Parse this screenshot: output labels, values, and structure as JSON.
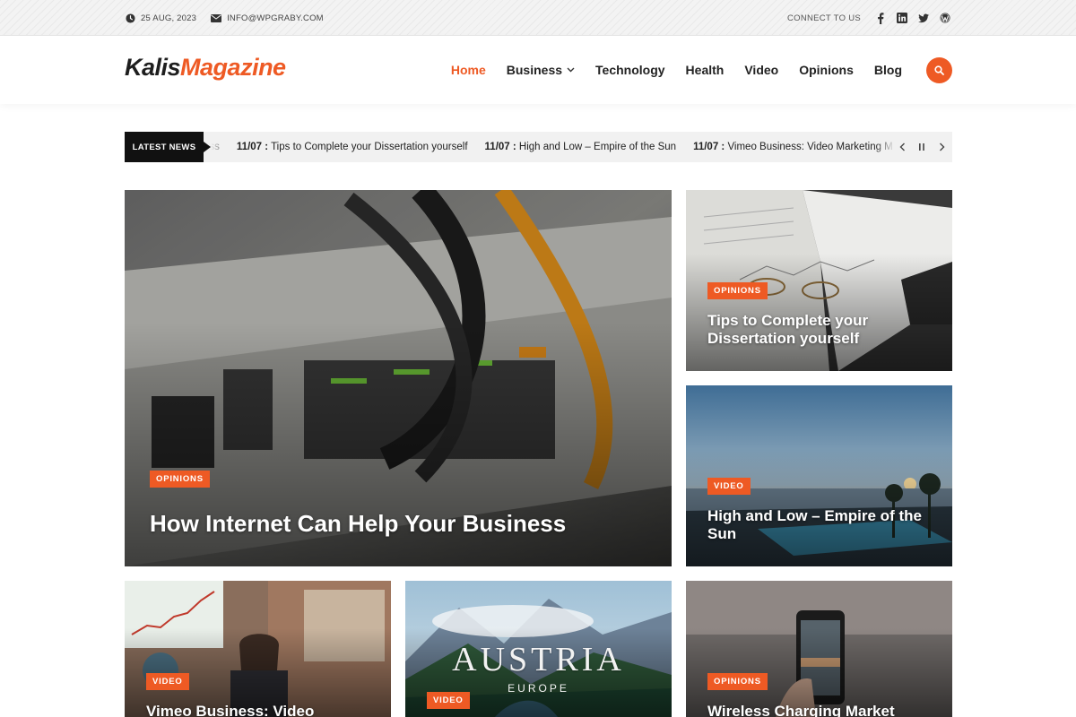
{
  "topbar": {
    "date": "25 AUG, 2023",
    "email": "INFO@WPGRABY.COM",
    "connect_label": "CONNECT TO US",
    "social_icons": [
      "facebook-icon",
      "linkedin-icon",
      "twitter-icon",
      "wordpress-icon"
    ]
  },
  "header": {
    "logo_part1": "Kalis",
    "logo_part2": "Magazine",
    "nav": [
      {
        "label": "Home",
        "active": true
      },
      {
        "label": "Business",
        "has_dropdown": true
      },
      {
        "label": "Technology"
      },
      {
        "label": "Health"
      },
      {
        "label": "Video"
      },
      {
        "label": "Opinions"
      },
      {
        "label": "Blog"
      }
    ],
    "search_icon": "search-icon"
  },
  "ticker": {
    "label": "LATEST NEWS",
    "items": [
      {
        "date": "",
        "title": "ess"
      },
      {
        "date": "11/07 :",
        "title": "Tips to Complete your Dissertation yourself"
      },
      {
        "date": "11/07 :",
        "title": "High and Low – Empire of the Sun"
      },
      {
        "date": "11/07 :",
        "title": "Vimeo Business: Video Marketing Made"
      }
    ],
    "controls": [
      "chevron-left-icon",
      "pause-icon",
      "chevron-right-icon"
    ]
  },
  "cards": [
    {
      "category": "OPINIONS",
      "title": "How Internet Can Help Your Business"
    },
    {
      "category": "OPINIONS",
      "title": "Tips to Complete your Dissertation yourself"
    },
    {
      "category": "VIDEO",
      "title": "High and Low – Empire of the Sun"
    },
    {
      "category": "VIDEO",
      "title": "Vimeo Business: Video"
    },
    {
      "category": "VIDEO",
      "title": "AUSTRIA",
      "subtitle": "EUROPE"
    },
    {
      "category": "OPINIONS",
      "title": "Wireless Charging Market"
    }
  ],
  "colors": {
    "accent": "#ee5a24",
    "dark": "#111111",
    "ticker_bg": "#f1f1f1"
  }
}
